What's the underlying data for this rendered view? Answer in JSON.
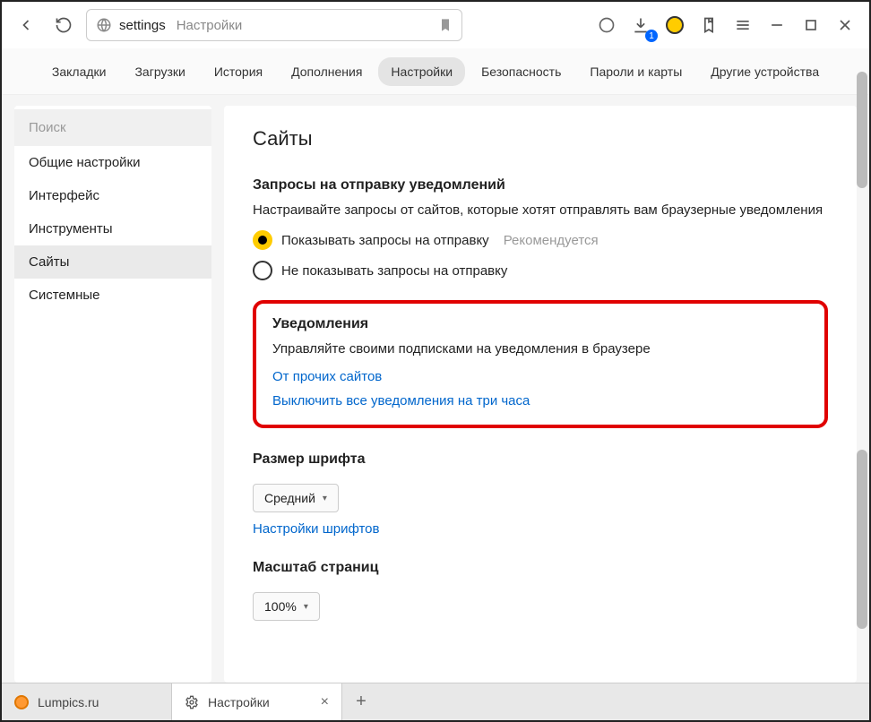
{
  "toolbar": {
    "url_proto": "settings",
    "url_title": "Настройки",
    "download_badge": "1"
  },
  "top_nav": {
    "items": [
      {
        "label": "Закладки"
      },
      {
        "label": "Загрузки"
      },
      {
        "label": "История"
      },
      {
        "label": "Дополнения"
      },
      {
        "label": "Настройки",
        "active": true
      },
      {
        "label": "Безопасность"
      },
      {
        "label": "Пароли и карты"
      },
      {
        "label": "Другие устройства"
      }
    ]
  },
  "sidebar": {
    "search_placeholder": "Поиск",
    "items": [
      {
        "label": "Общие настройки"
      },
      {
        "label": "Интерфейс"
      },
      {
        "label": "Инструменты"
      },
      {
        "label": "Сайты",
        "active": true
      },
      {
        "label": "Системные"
      }
    ]
  },
  "content": {
    "page_title": "Сайты",
    "s1_title": "Запросы на отправку уведомлений",
    "s1_desc": "Настраивайте запросы от сайтов, которые хотят отправлять вам браузерные уведомления",
    "s1_radio1": "Показывать запросы на отправку",
    "s1_radio1_hint": "Рекомендуется",
    "s1_radio2": "Не показывать запросы на отправку",
    "s2_title": "Уведомления",
    "s2_desc": "Управляйте своими подписками на уведомления в браузере",
    "s2_link1": "От прочих сайтов",
    "s2_link2": "Выключить все уведомления на три часа",
    "s3_title": "Размер шрифта",
    "s3_select": "Средний",
    "s3_link": "Настройки шрифтов",
    "s4_title": "Масштаб страниц",
    "s4_select": "100%"
  },
  "bottom_tabs": {
    "t1": "Lumpics.ru",
    "t2": "Настройки"
  }
}
